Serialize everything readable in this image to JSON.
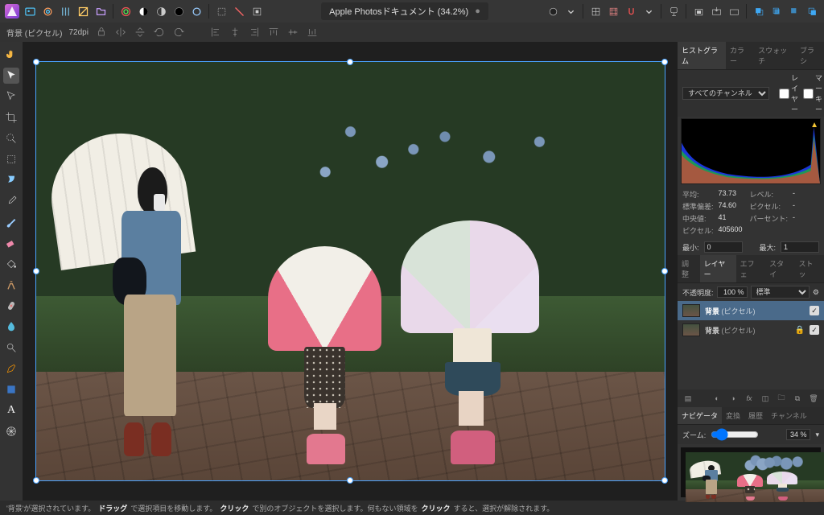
{
  "doc": {
    "title": "Apple Photosドキュメント (34.2%)",
    "dirty": "●"
  },
  "context": {
    "layer_kind": "背景 (ピクセル)",
    "dpi": "72dpi"
  },
  "panel_tabs": {
    "histogram": "ヒストグラム",
    "color": "カラー",
    "swatch": "スウォッチ",
    "brush": "ブラシ",
    "adjust": "調整",
    "layers": "レイヤー",
    "effects": "エフェ",
    "styles": "スタイ",
    "stock": "ストッ",
    "navigator": "ナビゲータ",
    "transform": "変換",
    "history": "履歴",
    "channel": "チャンネル"
  },
  "histogram": {
    "channel_label": "すべてのチャンネル",
    "toggle_layer": "レイヤー",
    "toggle_marquee": "マーキー",
    "stats": {
      "mean_label": "平均:",
      "mean": "73.73",
      "stddev_label": "標準偏差:",
      "stddev": "74.60",
      "median_label": "中央値:",
      "median": "41",
      "pixels_label": "ピクセル:",
      "pixels": "405600",
      "level_label": "レベル:",
      "level": "-",
      "pixel_label": "ピクセル:",
      "pixel": "-",
      "percent_label": "パーセント:",
      "percent": "-"
    },
    "min_label": "最小:",
    "min": "0",
    "max_label": "最大:",
    "max": "1"
  },
  "layers": {
    "opacity_label": "不透明度:",
    "opacity": "100 %",
    "blend": "標準",
    "items": [
      {
        "name": "背景",
        "suffix": "(ピクセル)",
        "active": true,
        "visible": true
      },
      {
        "name": "背景",
        "suffix": "(ピクセル)",
        "active": false,
        "visible": true,
        "locked": true
      }
    ]
  },
  "navigator": {
    "zoom_label": "ズーム:",
    "zoom": "34 %"
  },
  "status": {
    "pre": "'背景'が選択されています。",
    "s1a": "ドラッグ",
    "s1b": "で選択項目を移動します。",
    "s2a": "クリック",
    "s2b": "で別のオブジェクトを選択します。何もない領域を",
    "s3a": "クリック",
    "s3b": "すると、選択が解除されます。"
  }
}
